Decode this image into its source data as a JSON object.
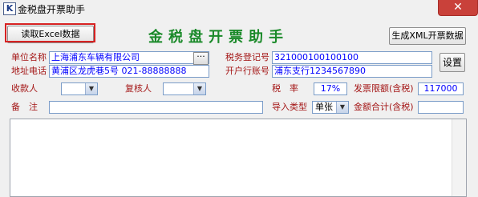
{
  "window": {
    "app_icon_letter": "K",
    "title": "金税盘开票助手",
    "close_glyph": "✕"
  },
  "toolbar": {
    "read_excel_label": "读取Excel数据",
    "header_title": "金税盘开票助手",
    "generate_xml_label": "生成XML开票数据",
    "settings_label": "设置"
  },
  "form": {
    "company_label": "单位名称",
    "company_value": "上海浦东车辆有限公司",
    "company_browse_label": "···",
    "address_label": "地址电话",
    "address_value": "黄浦区龙虎巷5号 021-88888888",
    "tax_id_label": "税务登记号",
    "tax_id_value": "321000100100100",
    "bank_label": "开户行账号",
    "bank_value": "浦东支行1234567890",
    "payee_label": "收款人",
    "payee_value": "",
    "reviewer_label": "复核人",
    "reviewer_value": "",
    "tax_rate_label": "税　率",
    "tax_rate_value": "17%",
    "invoice_limit_label": "发票限额(含税)",
    "invoice_limit_value": "117000",
    "remark_label": "备　注",
    "remark_value": "",
    "import_type_label": "导入类型",
    "import_type_value": "单张",
    "total_label": "金额合计(含税)",
    "total_value": ""
  },
  "icons": {
    "combo_arrow": "▼"
  },
  "colors": {
    "label_red": "#a41616",
    "title_green": "#1b8a2a",
    "value_blue": "#0000ff",
    "highlight_frame": "#d72222"
  }
}
